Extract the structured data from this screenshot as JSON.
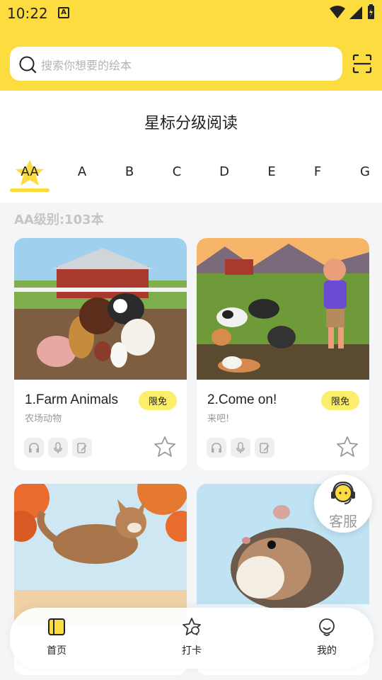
{
  "status": {
    "time": "10:22"
  },
  "search": {
    "placeholder": "搜索你想要的绘本"
  },
  "section": {
    "title": "星标分级阅读"
  },
  "levels": [
    "AA",
    "A",
    "B",
    "C",
    "D",
    "E",
    "F",
    "G"
  ],
  "count_text": "AA级别:103本",
  "books": [
    {
      "title": "1.Farm Animals",
      "subtitle": "农场动物",
      "badge": "限免"
    },
    {
      "title": "2.Come on!",
      "subtitle": "来吧!",
      "badge": "限免"
    },
    {
      "title": "",
      "subtitle": "",
      "badge": ""
    },
    {
      "title": "",
      "subtitle": "",
      "badge": ""
    }
  ],
  "service": {
    "label": "客服"
  },
  "nav": [
    {
      "label": "首页"
    },
    {
      "label": "打卡"
    },
    {
      "label": "我的"
    }
  ],
  "colors": {
    "accent": "#fcdc3e",
    "badge": "#fcee6a"
  }
}
